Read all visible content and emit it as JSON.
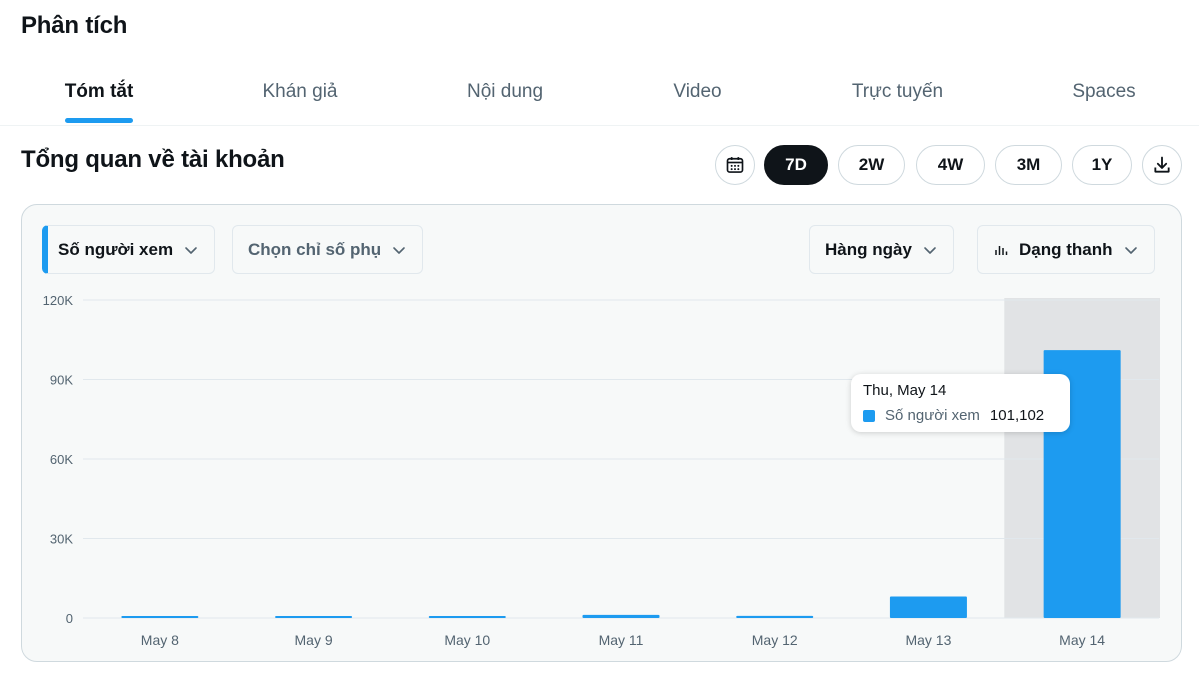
{
  "header": {
    "title": "Phân tích"
  },
  "tabs": [
    {
      "label": "Tóm tắt",
      "active": true
    },
    {
      "label": "Khán giả"
    },
    {
      "label": "Nội dung"
    },
    {
      "label": "Video"
    },
    {
      "label": "Trực tuyến"
    },
    {
      "label": "Spaces"
    }
  ],
  "overview": {
    "title": "Tổng quan về tài khoản",
    "ranges": [
      "7D",
      "2W",
      "4W",
      "3M",
      "1Y"
    ],
    "active_range": "7D",
    "icons": {
      "calendar": "calendar-icon",
      "download": "download-icon"
    }
  },
  "filters": {
    "metric": "Số người xem",
    "secondary": "Chọn chỉ số phụ",
    "granularity": "Hàng ngày",
    "chart_type": "Dạng thanh"
  },
  "tooltip": {
    "date": "Thu, May 14",
    "metric": "Số người xem",
    "value": "101,102"
  },
  "colors": {
    "accent": "#1d9bf0",
    "text": "#0f1419",
    "muted": "#536471",
    "highlight": "#e1e3e5"
  },
  "chart_data": {
    "type": "bar",
    "categories": [
      "May 8",
      "May 9",
      "May 10",
      "May 11",
      "May 12",
      "May 13",
      "May 14"
    ],
    "series": [
      {
        "name": "Số người xem",
        "values": [
          300,
          200,
          600,
          1200,
          800,
          8100,
          101102
        ]
      }
    ],
    "ylim": [
      0,
      120000
    ],
    "yticks": [
      0,
      30000,
      60000,
      90000,
      120000
    ],
    "ytick_labels": [
      "0",
      "30K",
      "60K",
      "90K",
      "120K"
    ],
    "highlighted_category": "May 14",
    "grid": true
  }
}
